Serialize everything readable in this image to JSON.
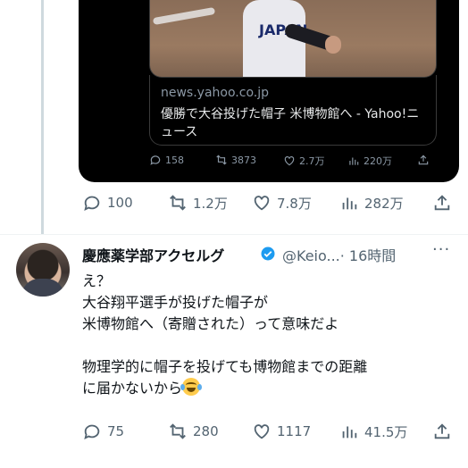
{
  "quoted": {
    "photo_jersey": "JAPAN",
    "link_domain": "news.yahoo.co.jp",
    "link_title": "優勝で大谷投げた帽子 米博物館へ - Yahoo!ニュース",
    "stats": {
      "replies": "158",
      "reposts": "3873",
      "likes": "2.7万",
      "views": "220万"
    }
  },
  "prev_tweet": {
    "stats": {
      "replies": "100",
      "reposts": "1.2万",
      "likes": "7.8万",
      "views": "282万"
    }
  },
  "tweet": {
    "author_name": "慶應薬学部アクセルグ",
    "handle": "@Keio...",
    "time": "· 16時間",
    "more": "···",
    "lines": [
      "え？",
      "大谷翔平選手が投げた帽子が",
      "米博物館へ（寄贈された）って意味だよ",
      "",
      "物理学的に帽子を投げても博物館までの距離",
      "に届かないから"
    ],
    "emoji": "joy-emoji",
    "stats": {
      "replies": "75",
      "reposts": "280",
      "likes": "1117",
      "views": "41.5万"
    }
  },
  "colors": {
    "accent": "#1d9bf0",
    "text": "#0f1419",
    "muted": "#536471",
    "quote_bg": "#000000"
  }
}
